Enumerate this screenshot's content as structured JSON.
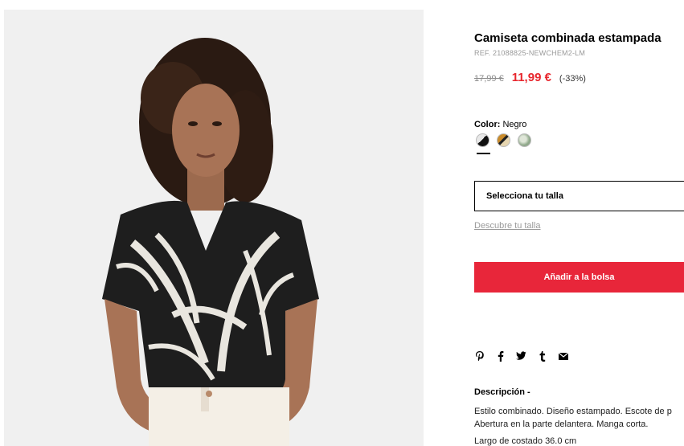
{
  "product": {
    "title": "Camiseta combinada estampada",
    "ref": "REF. 21088825-NEWCHEM2-LM",
    "old_price": "17,99 €",
    "new_price": "11,99 €",
    "discount": "(-33%)"
  },
  "color": {
    "label": "Color:",
    "selected": "Negro",
    "swatches": [
      {
        "name": "Negro",
        "colors": [
          "#111111",
          "#e8e8e8"
        ]
      },
      {
        "name": "Ocre",
        "colors": [
          "#c98b2a",
          "#222222"
        ]
      },
      {
        "name": "Verde",
        "colors": [
          "#8fa88a",
          "#dfe6d8"
        ]
      }
    ]
  },
  "size": {
    "select_label": "Selecciona tu talla",
    "guide_link": "Descubre tu talla"
  },
  "cart": {
    "add_label": "Añadir a la bolsa"
  },
  "social": {
    "icons": [
      "pinterest-icon",
      "facebook-icon",
      "twitter-icon",
      "tumblr-icon",
      "email-icon"
    ],
    "glyphs": [
      "P",
      "f",
      "t",
      "t",
      "✉"
    ]
  },
  "description": {
    "title": "Descripción -",
    "line1": "Estilo combinado. Diseño estampado. Escote de p",
    "line2": "Abertura en la parte delantera. Manga corta.",
    "line3": "Largo de costado 36.0 cm"
  },
  "colors": {
    "price_red": "#e8262d",
    "button_red": "#e8263a",
    "photo_bg": "#f0f0f0"
  }
}
